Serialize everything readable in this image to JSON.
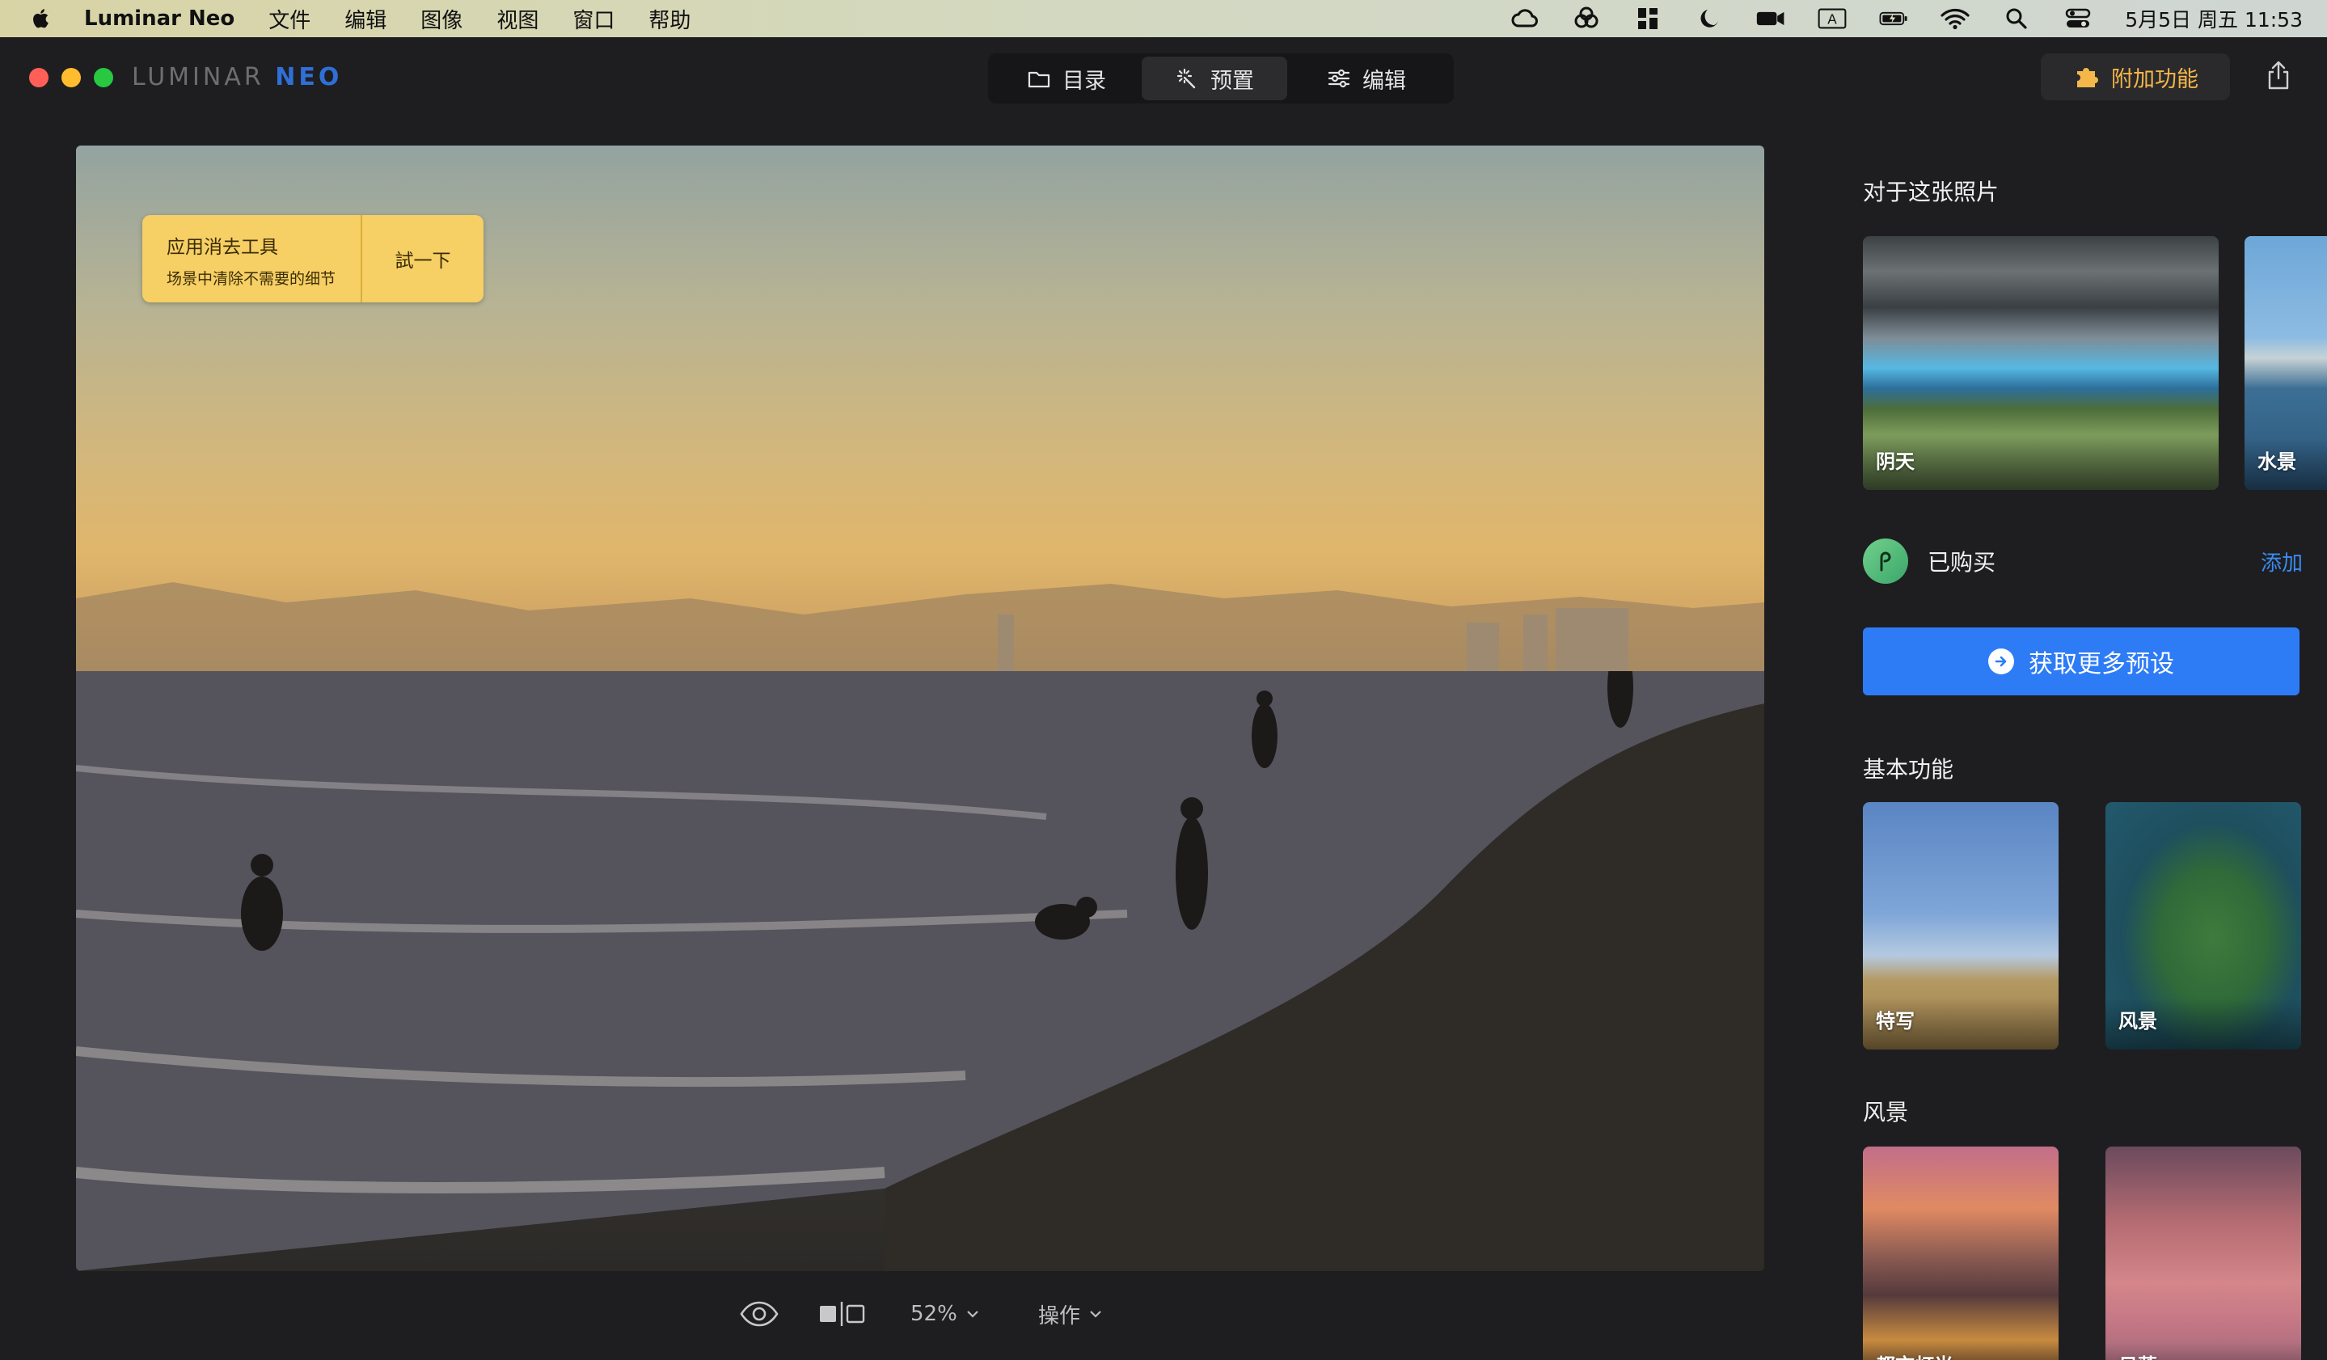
{
  "menubar": {
    "app_name": "Luminar Neo",
    "menus": [
      "文件",
      "编辑",
      "图像",
      "视图",
      "窗口",
      "帮助"
    ],
    "status_icons": [
      "creative-cloud-icon",
      "sync-icon",
      "grid-icon",
      "moon-icon",
      "camera-icon",
      "input-source-icon",
      "battery-icon",
      "wifi-icon",
      "search-icon",
      "control-center-icon"
    ],
    "input_source": "A",
    "clock": "5月5日 周五  11:53"
  },
  "titlebar": {
    "logo_luminar": "LUMINAR",
    "logo_neo": "NEO",
    "tabs": [
      {
        "label": "目录",
        "icon": "folder-icon"
      },
      {
        "label": "预置",
        "icon": "magic-wand-icon",
        "active": true
      },
      {
        "label": "编辑",
        "icon": "sliders-icon"
      }
    ],
    "addons_label": "附加功能"
  },
  "toast": {
    "title": "应用消去工具",
    "subtitle": "场景中清除不需要的细节",
    "action": "試一下"
  },
  "bottombar": {
    "zoom": "52%",
    "actions": "操作"
  },
  "panel": {
    "about_title": "对于这张照片",
    "about_cards": [
      {
        "label": "阴天"
      },
      {
        "label": "水景"
      }
    ],
    "purchased_label": "已购买",
    "add_label": "添加",
    "get_more_label": "获取更多预设",
    "basic_title": "基本功能",
    "basic_cards": [
      {
        "label": "特写"
      },
      {
        "label": "风景"
      }
    ],
    "landscape_title": "风景",
    "landscape_cards": [
      {
        "label": "都市灯光"
      },
      {
        "label": "日落"
      }
    ]
  },
  "colors": {
    "accent_blue": "#2d7cf6",
    "addons_orange": "#f5b64a",
    "toast_yellow": "#f6cf65"
  }
}
